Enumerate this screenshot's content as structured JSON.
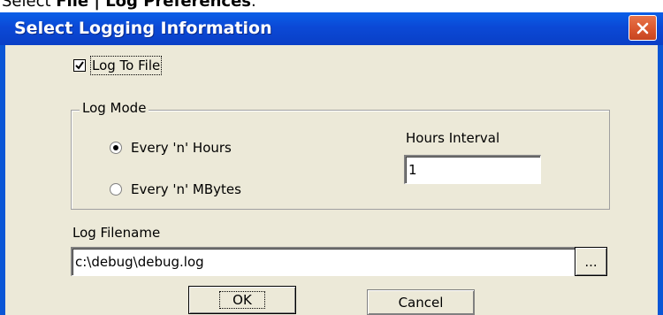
{
  "caption": {
    "prefix": "Select ",
    "menu_path": "File | Log Preferences",
    "suffix": "."
  },
  "dialog": {
    "title": "Select Logging Information",
    "close_icon": "close-icon"
  },
  "log_to_file": {
    "label": "Log To File",
    "checked": true
  },
  "log_mode": {
    "legend": "Log Mode",
    "options": [
      {
        "label": "Every 'n' Hours",
        "selected": true
      },
      {
        "label": "Every 'n' MBytes",
        "selected": false
      }
    ],
    "interval_label": "Hours Interval",
    "interval_value": "1"
  },
  "log_filename": {
    "label": "Log Filename",
    "value": "c:\\debug\\debug.log",
    "browse_label": "..."
  },
  "buttons": {
    "ok": "OK",
    "cancel": "Cancel"
  },
  "colors": {
    "titlebar": "#0a56d6",
    "close": "#d8552c",
    "face": "#ece9d8"
  }
}
